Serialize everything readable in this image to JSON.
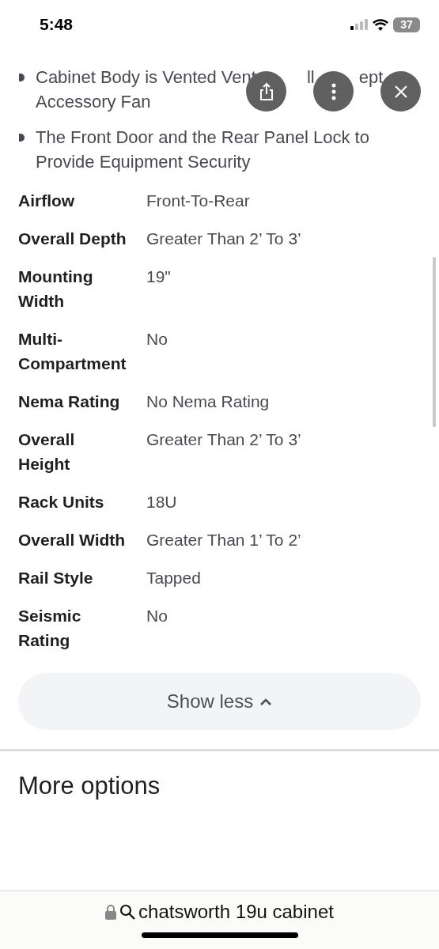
{
  "status_bar": {
    "time": "5:48",
    "battery": "37"
  },
  "bullets": [
    {
      "lines": [
        [
          "Cabinet Body is Vented Vent",
          "ll",
          "ept"
        ],
        [
          "Accessory Fan"
        ]
      ]
    },
    {
      "lines": [
        [
          "The Front Door and the Rear Panel Lock to"
        ],
        [
          "Provide Equipment Security"
        ]
      ]
    }
  ],
  "specs": [
    {
      "label": "Airflow",
      "value": "Front-To-Rear"
    },
    {
      "label": "Overall Depth",
      "value": "Greater Than 2’ To 3’"
    },
    {
      "label": "Mounting Width",
      "value": "19\""
    },
    {
      "label": "Multi-Compartment",
      "value": "No"
    },
    {
      "label": "Nema Rating",
      "value": "No Nema Rating"
    },
    {
      "label": "Overall Height",
      "value": "Greater Than 2’ To 3’"
    },
    {
      "label": "Rack Units",
      "value": "18U"
    },
    {
      "label": "Overall Width",
      "value": "Greater Than 1’ To 2’"
    },
    {
      "label": "Rail Style",
      "value": "Tapped"
    },
    {
      "label": "Seismic Rating",
      "value": "No"
    }
  ],
  "show_less_button": "Show less",
  "section_title": "More options",
  "address_bar": {
    "query": "chatsworth 19u cabinet"
  }
}
